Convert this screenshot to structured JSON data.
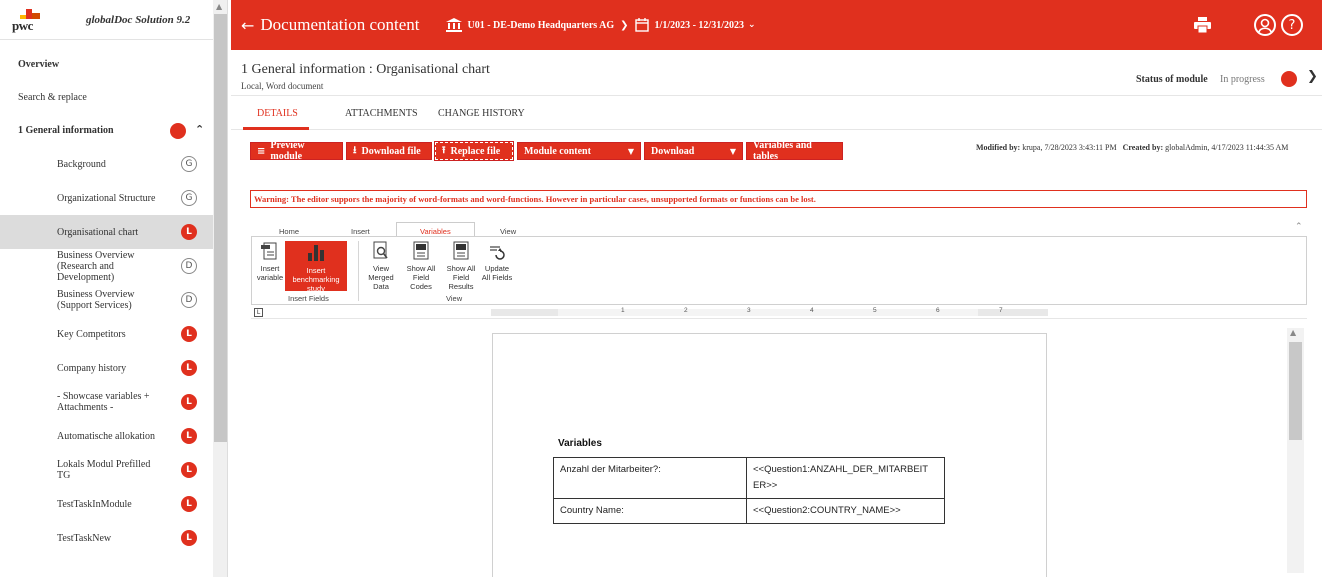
{
  "brand": {
    "logo_text": "pwc",
    "name": "globalDoc Solution 9.2"
  },
  "sidebar": {
    "top_items": [
      {
        "label": "Overview"
      },
      {
        "label": "Search & replace"
      }
    ],
    "section": {
      "label": "1 General information"
    },
    "items": [
      {
        "label": "Background",
        "badge": "G"
      },
      {
        "label": "Organizational Structure",
        "badge": "G"
      },
      {
        "label": "Organisational chart",
        "badge": "L"
      },
      {
        "label": "Business Overview (Research and Development)",
        "badge": "D"
      },
      {
        "label": "Business Overview (Support Services)",
        "badge": "D"
      },
      {
        "label": "Key Competitors",
        "badge": "L"
      },
      {
        "label": "Company history",
        "badge": "L"
      },
      {
        "label": "- Showcase variables + Attachments -",
        "badge": "L"
      },
      {
        "label": "Automatische allokation",
        "badge": "L"
      },
      {
        "label": "Lokals Modul Prefilled TG",
        "badge": "L"
      },
      {
        "label": "TestTaskInModule",
        "badge": "L"
      },
      {
        "label": "TestTaskNew",
        "badge": "L"
      }
    ]
  },
  "header": {
    "title": "Documentation content",
    "entity": "U01 - DE-Demo Headquarters AG",
    "period": "1/1/2023 - 12/31/2023"
  },
  "module": {
    "title": "1 General information : Organisational chart",
    "subtitle": "Local, Word document",
    "status_label": "Status of module",
    "status_value": "In progress"
  },
  "tabs": [
    {
      "label": "DETAILS"
    },
    {
      "label": "ATTACHMENTS"
    },
    {
      "label": "CHANGE HISTORY"
    }
  ],
  "actions": {
    "preview": "Preview module",
    "download_file": "Download file",
    "replace_file": "Replace file",
    "module_content": "Module content",
    "download": "Download",
    "variables_tables": "Variables and tables"
  },
  "modified": {
    "modified_label": "Modified by:",
    "modified_value": "krupa, 7/28/2023 3:43:11 PM",
    "created_label": "Created by:",
    "created_value": "globalAdmin, 4/17/2023 11:44:35 AM"
  },
  "warning": "Warning: The editor suppors the majority of word-formats and word-functions. However in particular cases, unsupported formats or functions can be lost.",
  "ribbon": {
    "tabs": [
      {
        "label": "Home"
      },
      {
        "label": "Insert"
      },
      {
        "label": "Variables"
      },
      {
        "label": "View"
      }
    ],
    "buttons": {
      "insert_variable": "Insert variable",
      "insert_benchmarking": "Insert benchmarking study",
      "view_merged": "View Merged Data",
      "show_field_codes": "Show All Field Codes",
      "show_field_results": "Show All Field Results",
      "update_fields": "Update All Fields"
    },
    "groups": {
      "insert_fields": "Insert Fields",
      "view": "View"
    }
  },
  "ruler": {
    "numbers": [
      "1",
      "2",
      "3",
      "4",
      "5",
      "6",
      "7"
    ]
  },
  "document": {
    "heading": "Variables",
    "rows": [
      {
        "label": "Anzahl der Mitarbeiter?:",
        "value": "<<Question1:ANZAHL_DER_MITARBEITER>>"
      },
      {
        "label": "Country Name:",
        "value": "<<Question2:COUNTRY_NAME>>"
      }
    ]
  },
  "colors": {
    "accent": "#e0301e",
    "active_row": "#dcdcdc"
  }
}
